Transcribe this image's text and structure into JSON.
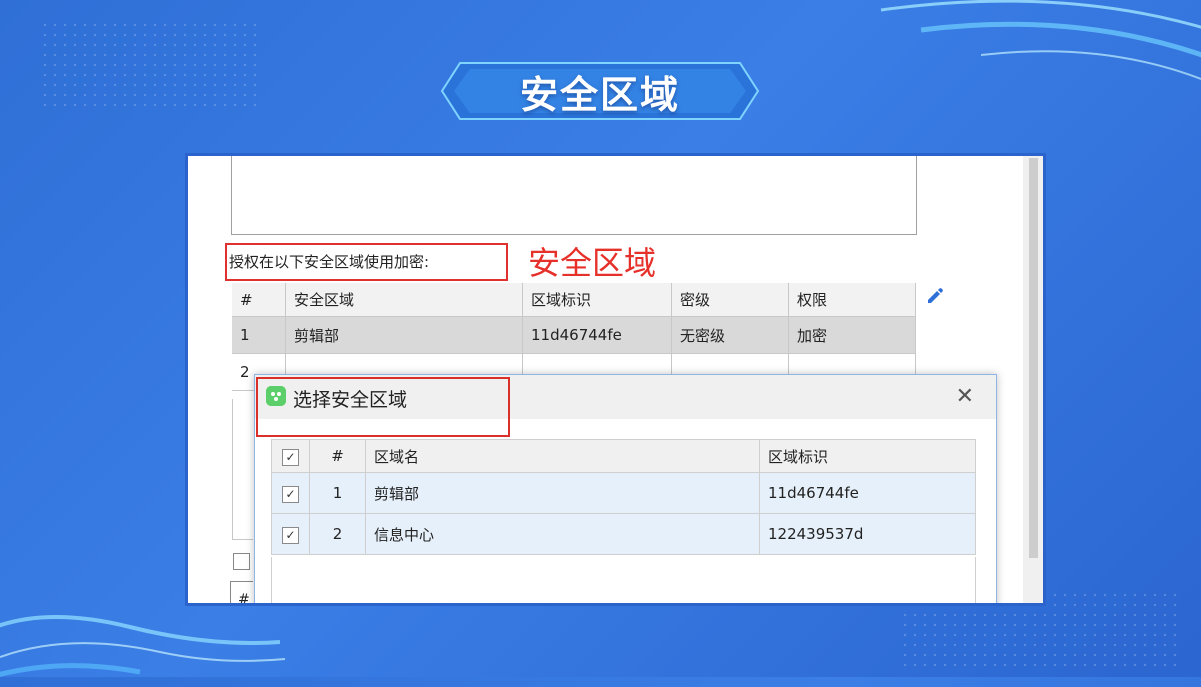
{
  "slide": {
    "title": "安全区域"
  },
  "panel": {
    "auth_label": "授权在以下安全区域使用加密:",
    "annotation": "安全区域",
    "table": {
      "headers": [
        "#",
        "安全区域",
        "区域标识",
        "密级",
        "权限"
      ],
      "rows": [
        [
          "1",
          "剪辑部",
          "11d46744fe",
          "无密级",
          "加密"
        ],
        [
          "2",
          "",
          "",
          "",
          ""
        ]
      ]
    },
    "partial_hash": "#",
    "edit_icon": "pencil-icon"
  },
  "dialog": {
    "title": "选择安全区域",
    "close_glyph": "✕",
    "table": {
      "headers": [
        "#",
        "区域名",
        "区域标识"
      ],
      "rows": [
        {
          "checked": true,
          "num": "1",
          "name": "剪辑部",
          "id": "11d46744fe"
        },
        {
          "checked": true,
          "num": "2",
          "name": "信息中心",
          "id": "122439537d"
        }
      ]
    }
  },
  "colors": {
    "background": "#3174dc",
    "annotation_red": "#e6302a",
    "selected_row": "#d9d9d9",
    "dialog_row": "#e6f0fa"
  }
}
